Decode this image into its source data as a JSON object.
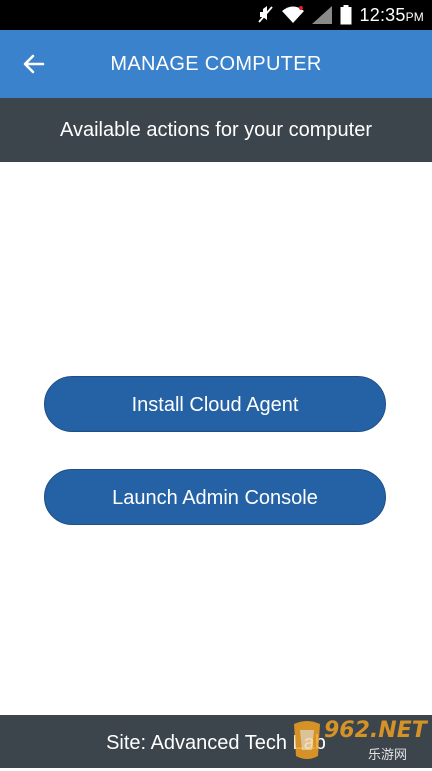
{
  "status_bar": {
    "time": "12:35",
    "ampm": "PM",
    "icons": [
      "mute-icon",
      "wifi-icon",
      "signal-icon",
      "battery-icon"
    ]
  },
  "app_bar": {
    "title": "MANAGE COMPUTER",
    "back_icon": "arrow-left-icon",
    "color": "#3a82cc"
  },
  "subheader": {
    "text": "Available actions for your computer"
  },
  "actions": [
    {
      "label": "Install Cloud Agent"
    },
    {
      "label": "Launch Admin Console"
    }
  ],
  "footer": {
    "text": "Site: Advanced Tech Lab"
  },
  "watermark": {
    "brand": "962.NET",
    "sub": "乐游网"
  },
  "colors": {
    "button": "#2462a5",
    "bar_dark": "#3c444c"
  }
}
